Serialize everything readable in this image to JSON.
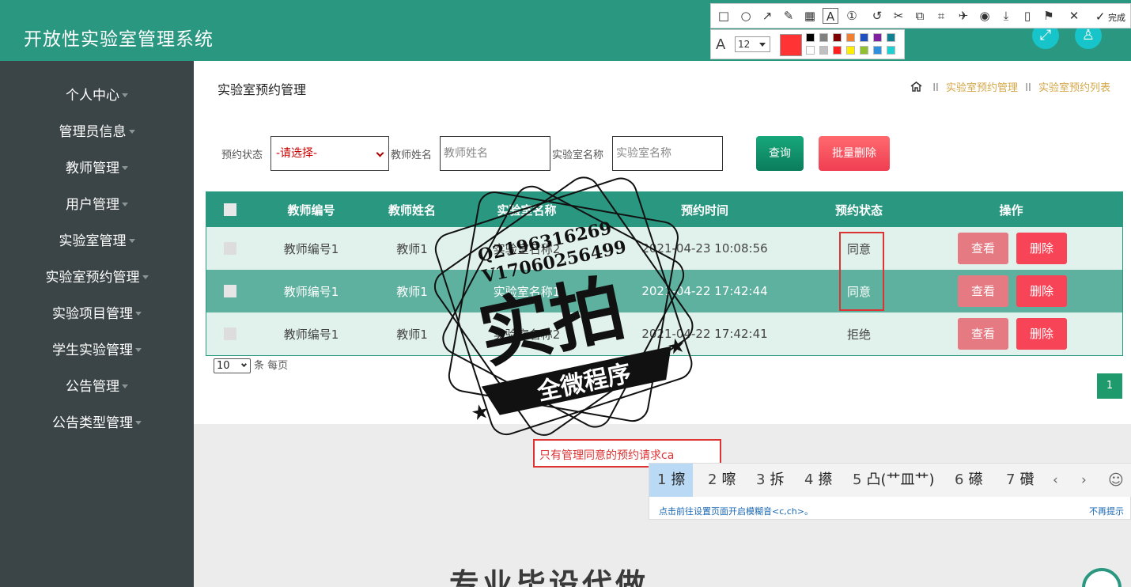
{
  "header": {
    "title": "开放性实验室管理系统",
    "fullscreen_icon": "expand-icon",
    "user_icon": "user-icon"
  },
  "sidebar": {
    "items": [
      {
        "label": "个人中心"
      },
      {
        "label": "管理员信息"
      },
      {
        "label": "教师管理"
      },
      {
        "label": "用户管理"
      },
      {
        "label": "实验室管理"
      },
      {
        "label": "实验室预约管理"
      },
      {
        "label": "实验项目管理"
      },
      {
        "label": "学生实验管理"
      },
      {
        "label": "公告管理"
      },
      {
        "label": "公告类型管理"
      }
    ]
  },
  "page": {
    "title": "实验室预约管理",
    "breadcrumb": {
      "sep": "II",
      "level1": "实验室预约管理",
      "level2": "实验室预约列表"
    }
  },
  "filters": {
    "status_label": "预约状态",
    "status_value": "-请选择-",
    "teacher_label": "教师姓名",
    "teacher_placeholder": "教师姓名",
    "lab_label": "实验室名称",
    "lab_placeholder": "实验室名称",
    "query_btn": "查询",
    "batch_delete_btn": "批量删除"
  },
  "table": {
    "headers": [
      "教师编号",
      "教师姓名",
      "实验室名称",
      "预约时间",
      "预约状态",
      "操作"
    ],
    "rows": [
      {
        "teacher_no": "教师编号1",
        "teacher_name": "教师1",
        "lab": "实验室名称2",
        "time": "2021-04-23 10:08:56",
        "status": "同意"
      },
      {
        "teacher_no": "教师编号1",
        "teacher_name": "教师1",
        "lab": "实验室名称1",
        "time": "2021-04-22 17:42:44",
        "status": "同意"
      },
      {
        "teacher_no": "教师编号1",
        "teacher_name": "教师1",
        "lab": "实验室名称2",
        "time": "2021-04-22 17:42:41",
        "status": "拒绝"
      }
    ],
    "view_btn": "查看",
    "delete_btn": "删除"
  },
  "pagination": {
    "page_size": "10",
    "page_size_suffix": "条 每页",
    "current_page": "1"
  },
  "annotation": {
    "note": "只有管理同意的预约请求ca"
  },
  "watermark": {
    "line1": "Q2196316269",
    "line2": "V17060256499",
    "big": "实拍",
    "banner": "全微程序"
  },
  "screenshot_toolbar": {
    "done_label": "完成",
    "font_size": "12",
    "current_color": "#ff3333",
    "swatches": [
      "#000000",
      "#808080",
      "#800000",
      "#f08030",
      "#2050c0",
      "#8020a0",
      "#108090",
      "#ffffff",
      "#c0c0c0",
      "#ff2020",
      "#ffee00",
      "#90c030",
      "#3090e0",
      "#20d0d0"
    ]
  },
  "ime": {
    "candidates": [
      {
        "n": "1",
        "c": "擦"
      },
      {
        "n": "2",
        "c": "嚓"
      },
      {
        "n": "3",
        "c": "拆"
      },
      {
        "n": "4",
        "c": "攃"
      },
      {
        "n": "5",
        "c": "凸(艹皿艹)"
      },
      {
        "n": "6",
        "c": "礤"
      },
      {
        "n": "7",
        "c": "礸"
      }
    ],
    "tip": "点击前往设置页面开启模糊音<c,ch>。",
    "dismiss": "不再提示"
  },
  "bottom": {
    "text": "专业毕设代做"
  }
}
